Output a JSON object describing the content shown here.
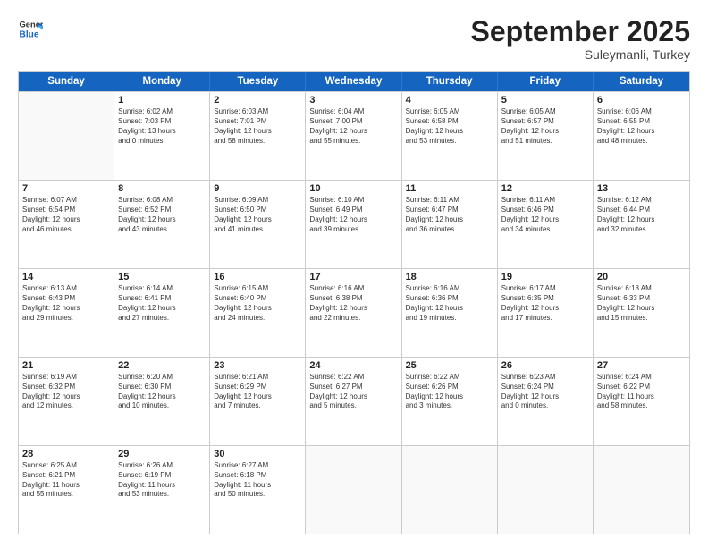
{
  "header": {
    "logo_line1": "General",
    "logo_line2": "Blue",
    "month": "September 2025",
    "location": "Suleymanli, Turkey"
  },
  "weekdays": [
    "Sunday",
    "Monday",
    "Tuesday",
    "Wednesday",
    "Thursday",
    "Friday",
    "Saturday"
  ],
  "rows": [
    [
      {
        "day": "",
        "info": ""
      },
      {
        "day": "1",
        "info": "Sunrise: 6:02 AM\nSunset: 7:03 PM\nDaylight: 13 hours\nand 0 minutes."
      },
      {
        "day": "2",
        "info": "Sunrise: 6:03 AM\nSunset: 7:01 PM\nDaylight: 12 hours\nand 58 minutes."
      },
      {
        "day": "3",
        "info": "Sunrise: 6:04 AM\nSunset: 7:00 PM\nDaylight: 12 hours\nand 55 minutes."
      },
      {
        "day": "4",
        "info": "Sunrise: 6:05 AM\nSunset: 6:58 PM\nDaylight: 12 hours\nand 53 minutes."
      },
      {
        "day": "5",
        "info": "Sunrise: 6:05 AM\nSunset: 6:57 PM\nDaylight: 12 hours\nand 51 minutes."
      },
      {
        "day": "6",
        "info": "Sunrise: 6:06 AM\nSunset: 6:55 PM\nDaylight: 12 hours\nand 48 minutes."
      }
    ],
    [
      {
        "day": "7",
        "info": "Sunrise: 6:07 AM\nSunset: 6:54 PM\nDaylight: 12 hours\nand 46 minutes."
      },
      {
        "day": "8",
        "info": "Sunrise: 6:08 AM\nSunset: 6:52 PM\nDaylight: 12 hours\nand 43 minutes."
      },
      {
        "day": "9",
        "info": "Sunrise: 6:09 AM\nSunset: 6:50 PM\nDaylight: 12 hours\nand 41 minutes."
      },
      {
        "day": "10",
        "info": "Sunrise: 6:10 AM\nSunset: 6:49 PM\nDaylight: 12 hours\nand 39 minutes."
      },
      {
        "day": "11",
        "info": "Sunrise: 6:11 AM\nSunset: 6:47 PM\nDaylight: 12 hours\nand 36 minutes."
      },
      {
        "day": "12",
        "info": "Sunrise: 6:11 AM\nSunset: 6:46 PM\nDaylight: 12 hours\nand 34 minutes."
      },
      {
        "day": "13",
        "info": "Sunrise: 6:12 AM\nSunset: 6:44 PM\nDaylight: 12 hours\nand 32 minutes."
      }
    ],
    [
      {
        "day": "14",
        "info": "Sunrise: 6:13 AM\nSunset: 6:43 PM\nDaylight: 12 hours\nand 29 minutes."
      },
      {
        "day": "15",
        "info": "Sunrise: 6:14 AM\nSunset: 6:41 PM\nDaylight: 12 hours\nand 27 minutes."
      },
      {
        "day": "16",
        "info": "Sunrise: 6:15 AM\nSunset: 6:40 PM\nDaylight: 12 hours\nand 24 minutes."
      },
      {
        "day": "17",
        "info": "Sunrise: 6:16 AM\nSunset: 6:38 PM\nDaylight: 12 hours\nand 22 minutes."
      },
      {
        "day": "18",
        "info": "Sunrise: 6:16 AM\nSunset: 6:36 PM\nDaylight: 12 hours\nand 19 minutes."
      },
      {
        "day": "19",
        "info": "Sunrise: 6:17 AM\nSunset: 6:35 PM\nDaylight: 12 hours\nand 17 minutes."
      },
      {
        "day": "20",
        "info": "Sunrise: 6:18 AM\nSunset: 6:33 PM\nDaylight: 12 hours\nand 15 minutes."
      }
    ],
    [
      {
        "day": "21",
        "info": "Sunrise: 6:19 AM\nSunset: 6:32 PM\nDaylight: 12 hours\nand 12 minutes."
      },
      {
        "day": "22",
        "info": "Sunrise: 6:20 AM\nSunset: 6:30 PM\nDaylight: 12 hours\nand 10 minutes."
      },
      {
        "day": "23",
        "info": "Sunrise: 6:21 AM\nSunset: 6:29 PM\nDaylight: 12 hours\nand 7 minutes."
      },
      {
        "day": "24",
        "info": "Sunrise: 6:22 AM\nSunset: 6:27 PM\nDaylight: 12 hours\nand 5 minutes."
      },
      {
        "day": "25",
        "info": "Sunrise: 6:22 AM\nSunset: 6:26 PM\nDaylight: 12 hours\nand 3 minutes."
      },
      {
        "day": "26",
        "info": "Sunrise: 6:23 AM\nSunset: 6:24 PM\nDaylight: 12 hours\nand 0 minutes."
      },
      {
        "day": "27",
        "info": "Sunrise: 6:24 AM\nSunset: 6:22 PM\nDaylight: 11 hours\nand 58 minutes."
      }
    ],
    [
      {
        "day": "28",
        "info": "Sunrise: 6:25 AM\nSunset: 6:21 PM\nDaylight: 11 hours\nand 55 minutes."
      },
      {
        "day": "29",
        "info": "Sunrise: 6:26 AM\nSunset: 6:19 PM\nDaylight: 11 hours\nand 53 minutes."
      },
      {
        "day": "30",
        "info": "Sunrise: 6:27 AM\nSunset: 6:18 PM\nDaylight: 11 hours\nand 50 minutes."
      },
      {
        "day": "",
        "info": ""
      },
      {
        "day": "",
        "info": ""
      },
      {
        "day": "",
        "info": ""
      },
      {
        "day": "",
        "info": ""
      }
    ]
  ]
}
